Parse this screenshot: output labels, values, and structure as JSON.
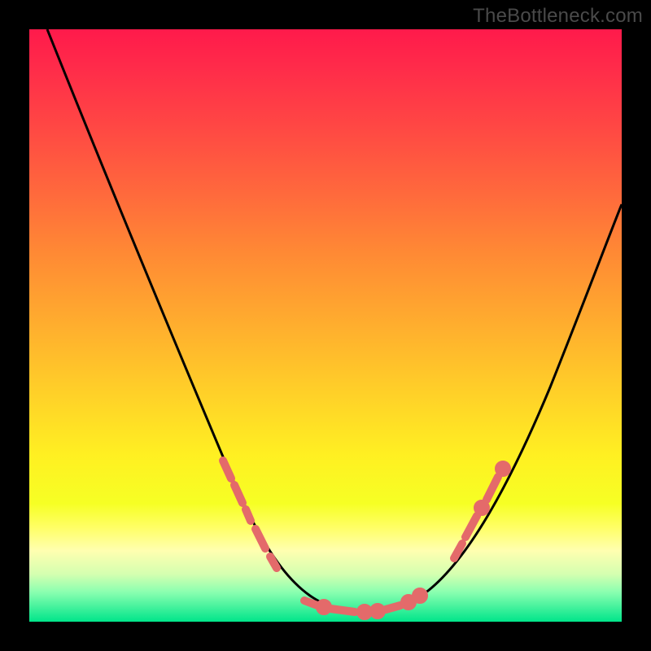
{
  "watermark": "TheBottleneck.com",
  "chart_data": {
    "type": "line",
    "title": "",
    "xlabel": "",
    "ylabel": "",
    "xlim": [
      0,
      100
    ],
    "ylim": [
      0,
      100
    ],
    "series": [
      {
        "name": "bottleneck-curve",
        "x": [
          3,
          10,
          18,
          26,
          34,
          42,
          48,
          52,
          54,
          58,
          64,
          70,
          78,
          86,
          94,
          100
        ],
        "values": [
          100,
          83,
          65,
          49,
          35,
          22,
          12,
          6,
          3,
          2,
          4,
          10,
          22,
          38,
          56,
          70
        ]
      }
    ],
    "annotations": [
      {
        "name": "marker-cluster-left",
        "x_from": 33,
        "x_to": 40,
        "y_from": 24,
        "y_to": 12
      },
      {
        "name": "marker-cluster-floor",
        "x_from": 48,
        "x_to": 66,
        "y_from": 4,
        "y_to": 4
      },
      {
        "name": "marker-cluster-right",
        "x_from": 72,
        "x_to": 80,
        "y_from": 14,
        "y_to": 26
      }
    ],
    "colors": {
      "curve": "#000000",
      "marker": "#e46a6a",
      "gradient_top": "#ff1a4b",
      "gradient_mid": "#ffd228",
      "gradient_bottom": "#00e58a"
    }
  }
}
